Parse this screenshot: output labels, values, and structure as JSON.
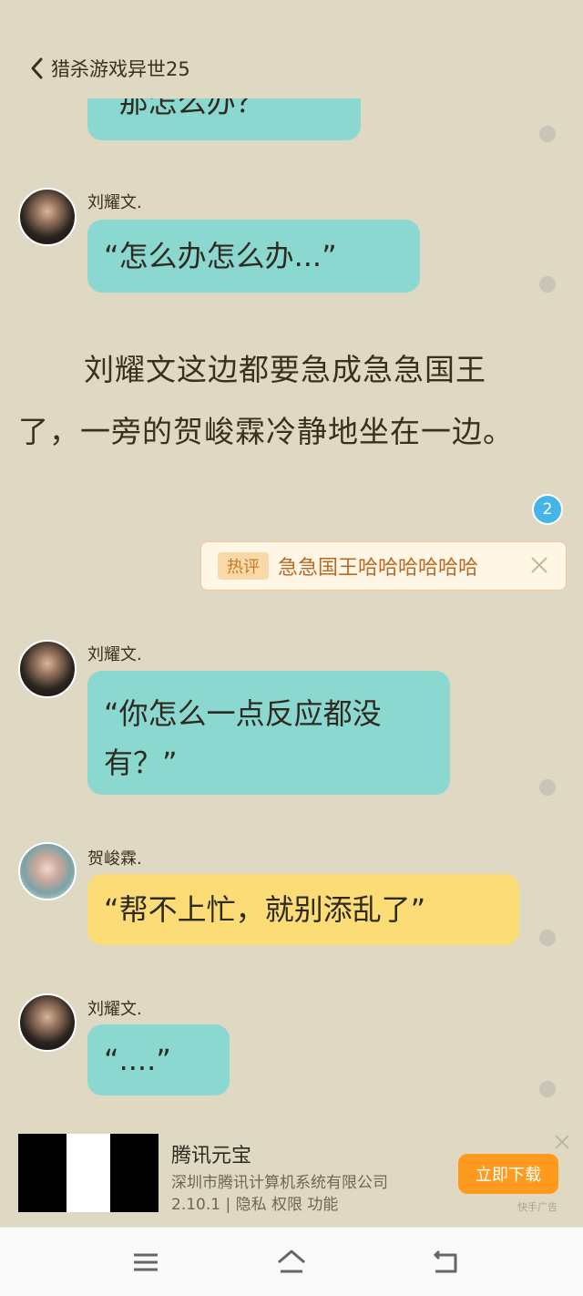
{
  "header": {
    "title": "猎杀游戏异世25"
  },
  "messages": [
    {
      "text": "“那怎么办？”"
    },
    {
      "name": "刘耀文.",
      "text": "“怎么办怎么办...”"
    },
    {
      "name": "刘耀文.",
      "text": "“你怎么一点反应都没有？”"
    },
    {
      "name": "贺峻霖.",
      "text": "“帮不上忙，就别添乱了”"
    },
    {
      "name": "刘耀文.",
      "text": "“....”"
    }
  ],
  "narration": "刘耀文这边都要急成急急国王了，一旁的贺峻霖冷静地坐在一边。",
  "comment": {
    "count": "2",
    "tag": "热评",
    "text": "急急国王哈哈哈哈哈哈"
  },
  "ad": {
    "title": "腾讯元宝",
    "company": "深圳市腾讯计算机系统有限公司",
    "meta": "2.10.1 | 隐私  权限  功能",
    "button": "立即下载",
    "label": "快手广告"
  },
  "colors": {
    "background": "#dfd9c3",
    "bubble_teal": "#8bd8d1",
    "bubble_yellow": "#fbdc76",
    "badge": "#45b5e8",
    "ad_button": "#ff9a1e"
  },
  "icons": [
    "chevron-left-icon",
    "close-icon",
    "menu-icon",
    "home-icon",
    "back-icon"
  ]
}
